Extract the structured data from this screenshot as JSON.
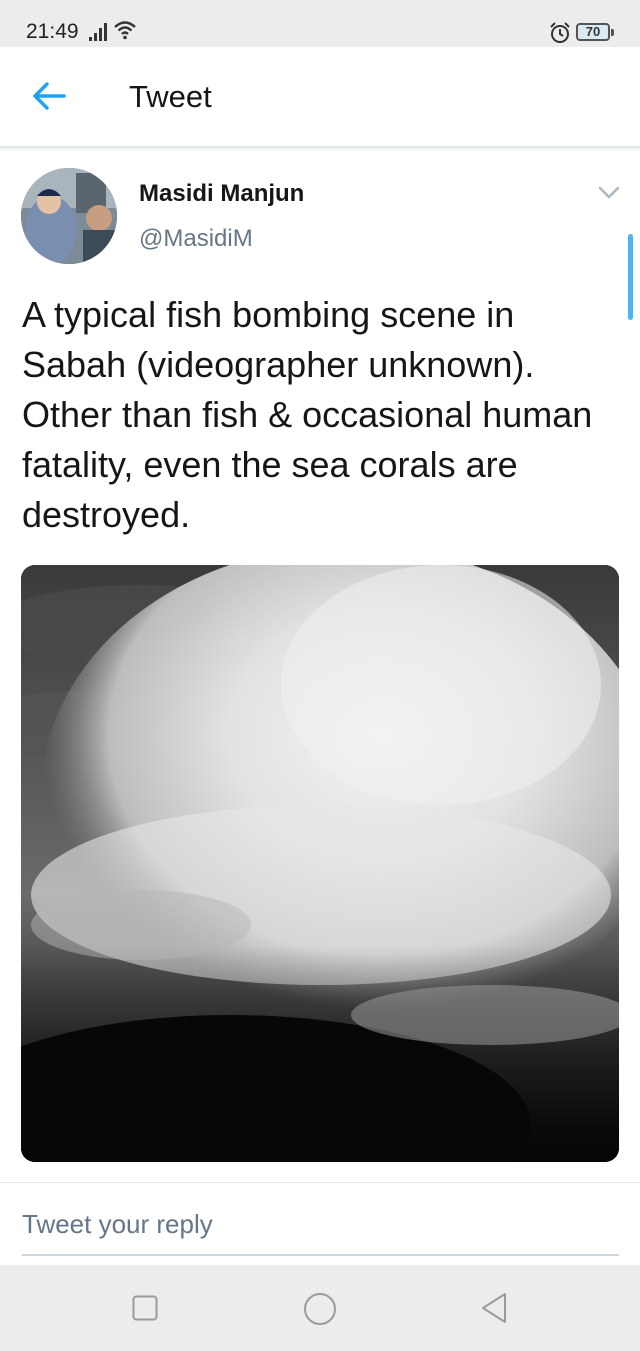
{
  "status_bar": {
    "time": "21:49",
    "battery": "70"
  },
  "header": {
    "title": "Tweet",
    "back_icon": "arrow-left-icon"
  },
  "tweet": {
    "display_name": "Masidi Manjun",
    "handle": "@MasidiM",
    "text": "A typical fish bombing scene in Sabah (videographer unknown). Other than fish & occasional human fatality, even the sea corals are destroyed.",
    "menu_icon": "chevron-down-icon"
  },
  "reply": {
    "placeholder": "Tweet your reply"
  },
  "colors": {
    "accent": "#1da1f2",
    "text_primary": "#14171a",
    "text_secondary": "#657786",
    "divider": "#e1e8ed"
  },
  "nav_bar": {
    "icons": [
      "square-recents-icon",
      "circle-home-icon",
      "triangle-back-icon"
    ]
  }
}
